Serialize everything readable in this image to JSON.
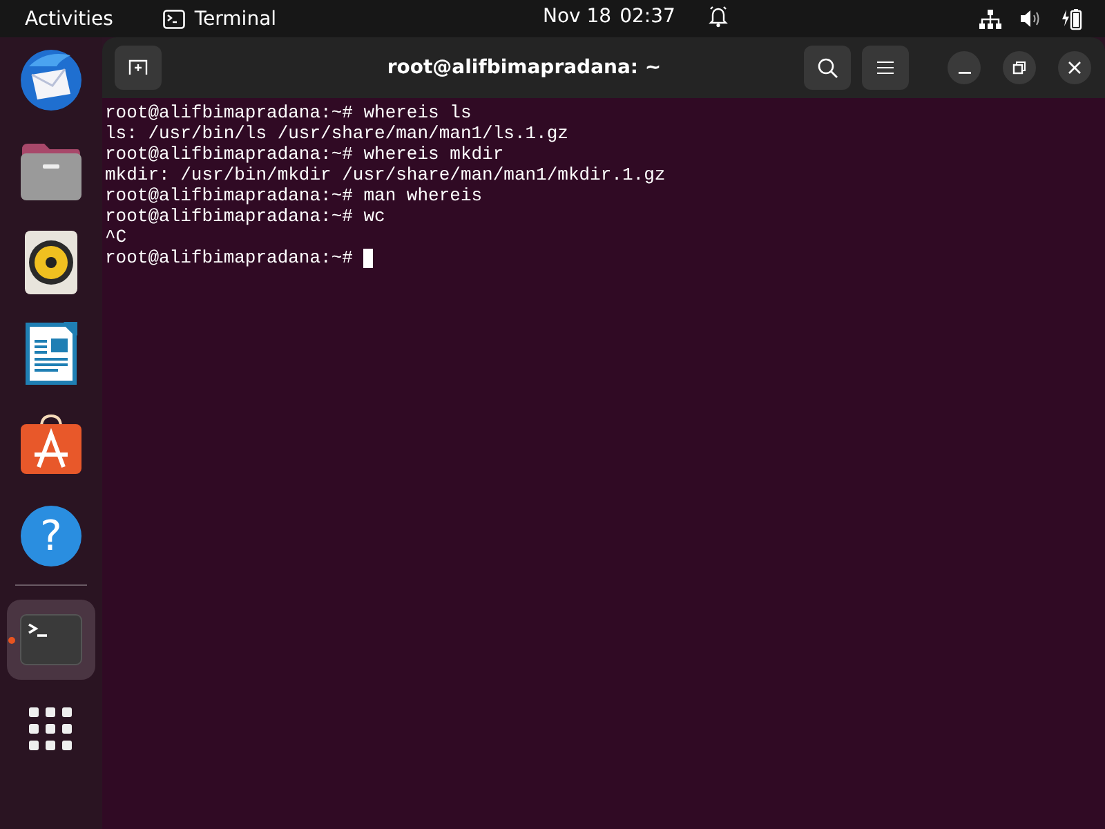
{
  "top_bar": {
    "activities": "Activities",
    "app_menu": "Terminal",
    "date": "Nov 18",
    "time": "02:37"
  },
  "dock": {
    "items": [
      {
        "kind": "mail",
        "running": false
      },
      {
        "kind": "files",
        "running": false
      },
      {
        "kind": "music",
        "running": false
      },
      {
        "kind": "writer",
        "running": false
      },
      {
        "kind": "store",
        "running": false
      },
      {
        "kind": "help",
        "glyph": "?",
        "running": false
      },
      {
        "kind": "terminal",
        "running": true
      }
    ]
  },
  "window": {
    "title": "root@alifbimapradana: ~"
  },
  "terminal": {
    "lines": [
      "root@alifbimapradana:~# whereis ls",
      "ls: /usr/bin/ls /usr/share/man/man1/ls.1.gz",
      "root@alifbimapradana:~# whereis mkdir",
      "mkdir: /usr/bin/mkdir /usr/share/man/man1/mkdir.1.gz",
      "root@alifbimapradana:~# man whereis",
      "root@alifbimapradana:~# wc",
      "^C",
      "root@alifbimapradana:~# "
    ]
  }
}
